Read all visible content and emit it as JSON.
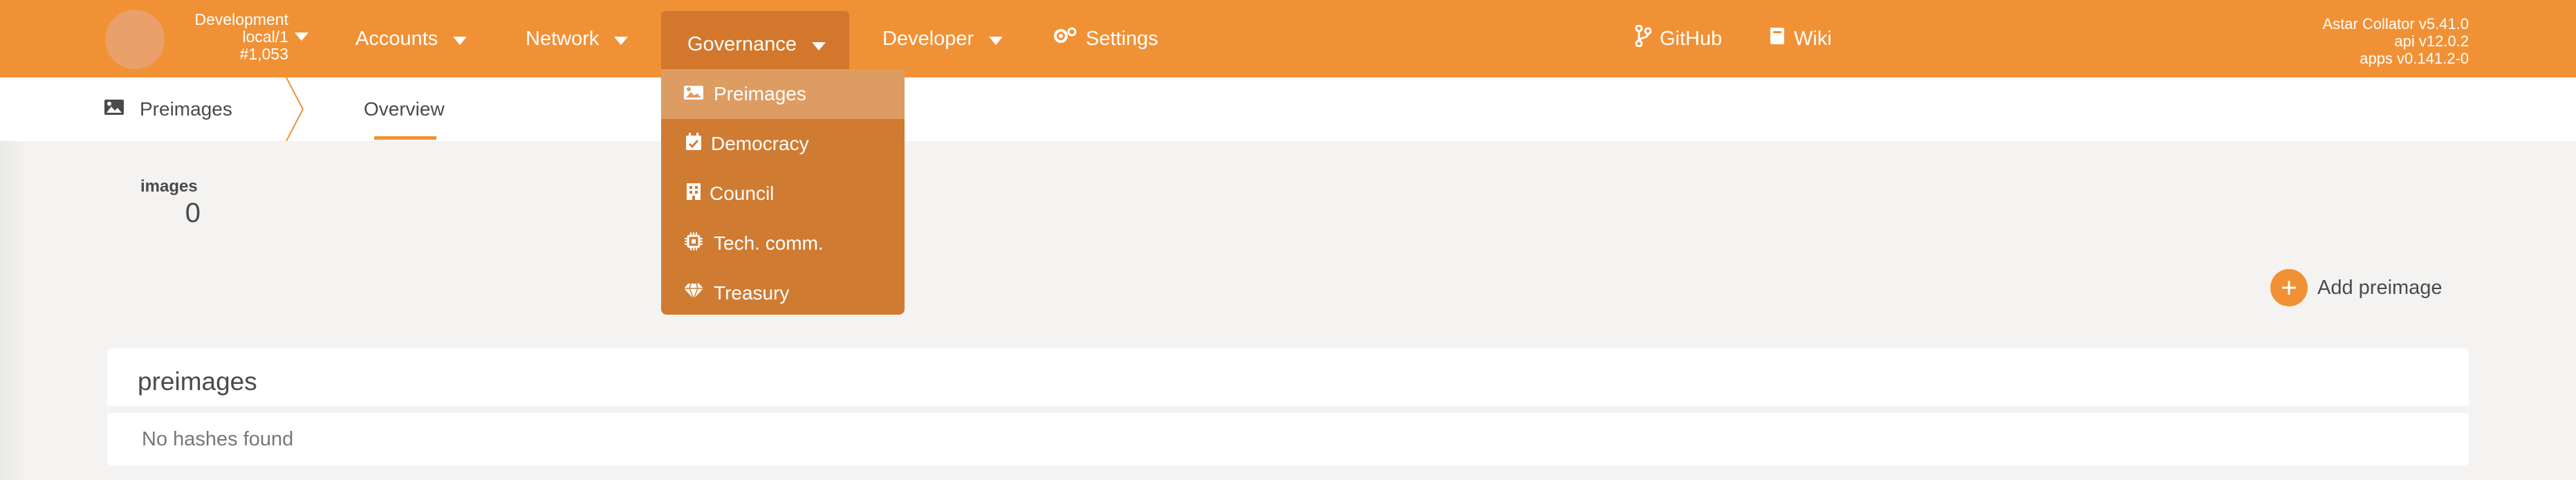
{
  "chain": {
    "name": "Development",
    "endpoint": "local/1",
    "block": "#1,053"
  },
  "nav": {
    "accounts": "Accounts",
    "network": "Network",
    "governance": "Governance",
    "developer": "Developer",
    "settings": "Settings",
    "github": "GitHub",
    "wiki": "Wiki"
  },
  "version": {
    "node": "Astar Collator v5.41.0",
    "api": "api v12.0.2",
    "apps": "apps v0.141.2-0"
  },
  "dropdown": {
    "items": [
      {
        "label": "Preimages",
        "icon": "image-icon"
      },
      {
        "label": "Democracy",
        "icon": "calendar-check-icon"
      },
      {
        "label": "Council",
        "icon": "building-icon"
      },
      {
        "label": "Tech. comm.",
        "icon": "microchip-icon"
      },
      {
        "label": "Treasury",
        "icon": "gem-icon"
      }
    ]
  },
  "subnav": {
    "section": "Preimages",
    "tab": "Overview"
  },
  "summary": {
    "label": "images",
    "value": "0"
  },
  "actions": {
    "add": "Add preimage"
  },
  "table": {
    "title": "preimages",
    "empty": "No hashes found"
  },
  "colors": {
    "accent": "#f19135",
    "menu": "#d07b32",
    "menu_active": "#dd9c62"
  }
}
